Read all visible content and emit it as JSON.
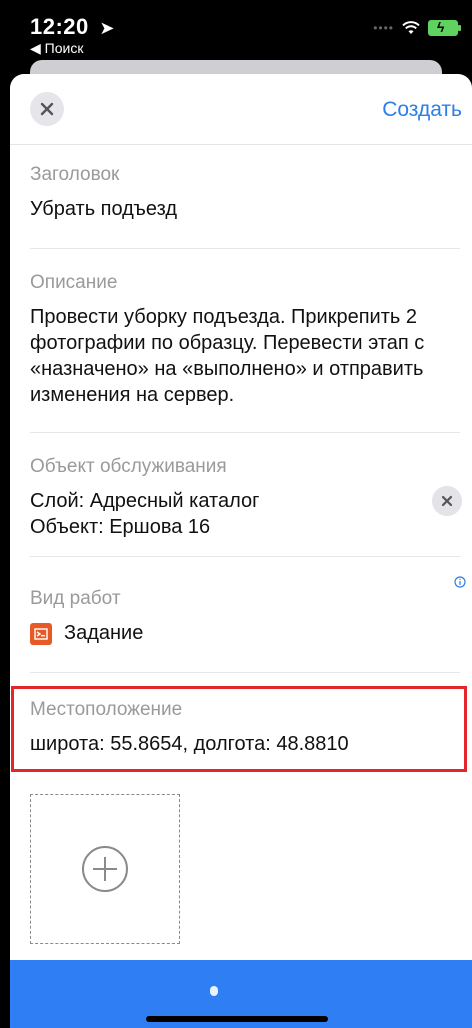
{
  "status_bar": {
    "time": "12:20",
    "back_app": "◀ Поиск"
  },
  "header": {
    "create_label": "Создать"
  },
  "fields": {
    "title": {
      "label": "Заголовок",
      "value": "Убрать подъезд"
    },
    "description": {
      "label": "Описание",
      "value": "Провести уборку подъезда. Прикрепить 2 фотографии по образцу. Перевести этап с «назначено» на «выполнено» и отправить изменения на сервер."
    },
    "object": {
      "label": "Объект обслуживания",
      "line1": "Слой: Адресный каталог",
      "line2": "Объект: Ершова 16"
    },
    "work_type": {
      "label": "Вид работ",
      "value": "Задание"
    },
    "location": {
      "label": "Местоположение",
      "value": "широта: 55.8654, долгота: 48.8810"
    }
  },
  "colors": {
    "accent": "#2d7ee6",
    "highlight": "#e1262d",
    "task_icon": "#e65a28",
    "bottom_bar": "#2f7ef3"
  },
  "icons": [
    "location-arrow-icon",
    "wifi-icon",
    "battery-icon",
    "close-icon",
    "clear-icon",
    "info-icon",
    "task-icon",
    "plus-icon"
  ]
}
